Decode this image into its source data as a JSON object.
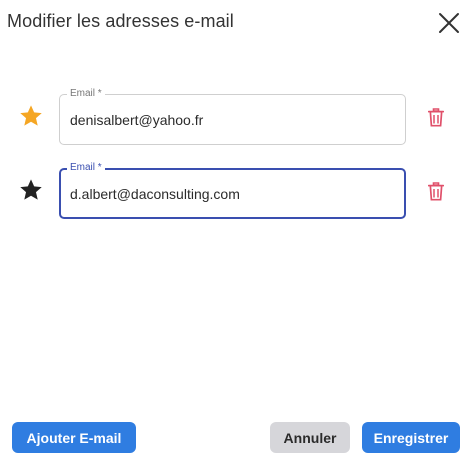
{
  "dialog": {
    "title": "Modifier les adresses e-mail",
    "close_icon": "close-icon"
  },
  "emails": [
    {
      "label": "Email *",
      "value": "denisalbert@yahoo.fr",
      "primary": true,
      "star_icon": "star-filled-icon",
      "star_color": "#f5a623",
      "delete_icon": "trash-icon",
      "focused": false
    },
    {
      "label": "Email *",
      "value": "d.albert@daconsulting.com",
      "primary": false,
      "star_icon": "star-filled-icon",
      "star_color": "#222222",
      "delete_icon": "trash-icon",
      "focused": true
    }
  ],
  "footer": {
    "add_label": "Ajouter E-mail",
    "cancel_label": "Annuler",
    "save_label": "Enregistrer"
  },
  "colors": {
    "primary": "#2f7de1",
    "focus": "#3a4fb0",
    "danger": "#e0506a",
    "star_primary": "#f5a623"
  }
}
